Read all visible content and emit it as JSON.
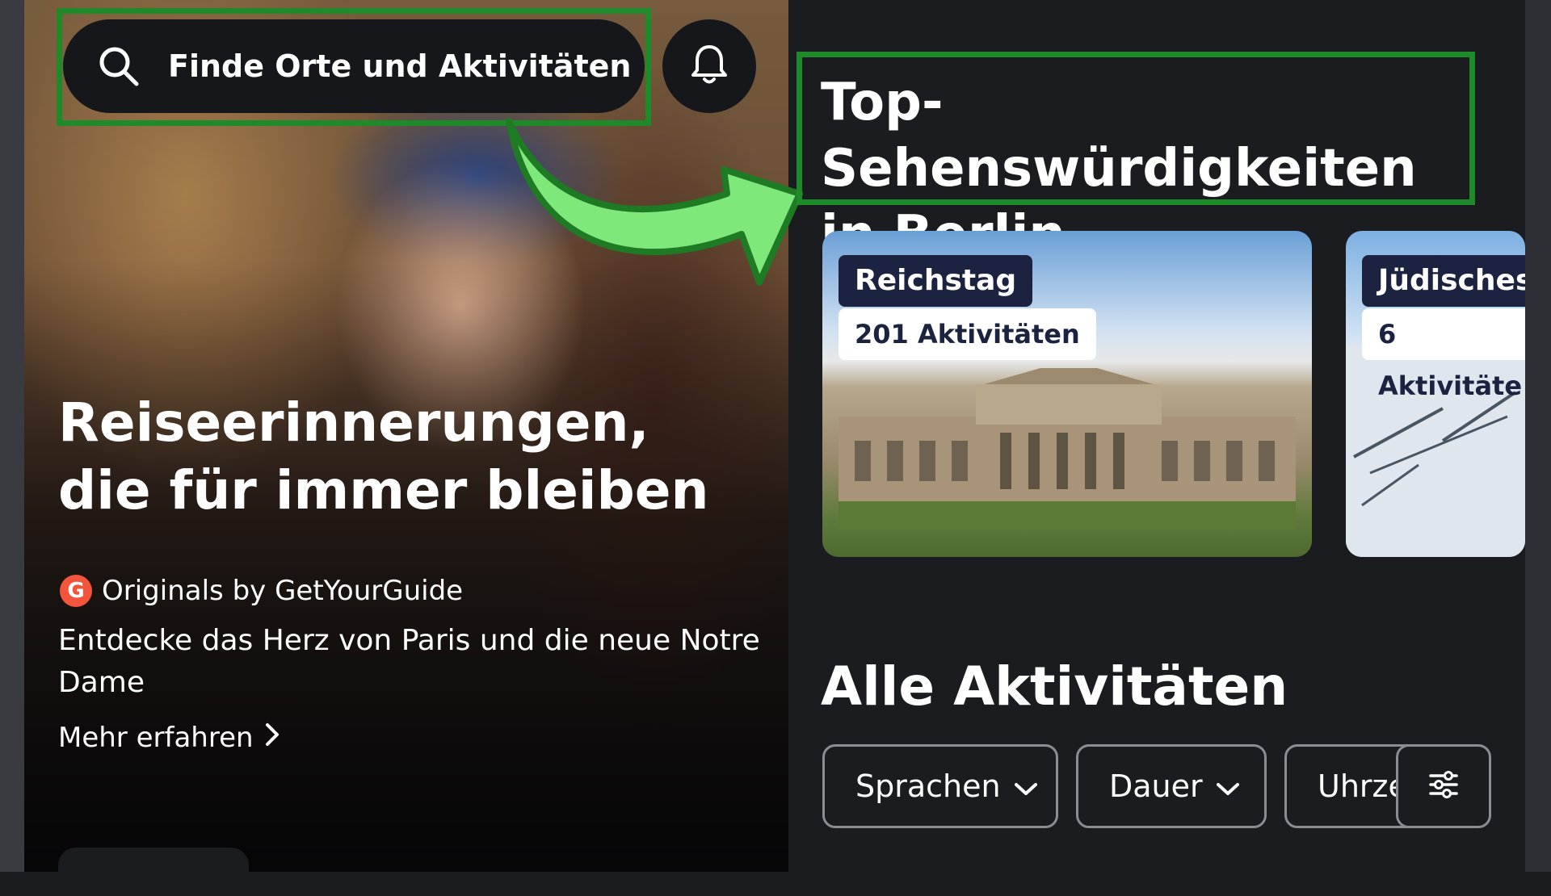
{
  "search": {
    "placeholder": "Finde Orte und Aktivitäten"
  },
  "hero": {
    "title_line1": "Reiseerinnerungen,",
    "title_line2": "die für immer bleiben",
    "brand_badge": "G",
    "brand": "Originals by GetYourGuide",
    "description": "Entdecke das Herz von Paris und die neue Notre Dame",
    "more_link": "Mehr erfahren"
  },
  "top_section": {
    "title_line1": "Top-Sehenswürdigkeiten",
    "title_line2": "in Berlin",
    "cards": [
      {
        "name": "Reichstag",
        "count": "201 Aktivitäten"
      },
      {
        "name": "Jüdisches /",
        "count": "6 Aktivitäte"
      }
    ]
  },
  "all_section": {
    "title": "Alle Aktivitäten",
    "filters": [
      {
        "label": "Sprachen"
      },
      {
        "label": "Dauer"
      },
      {
        "label": "Uhrze"
      }
    ]
  },
  "colors": {
    "highlight": "#1f8a2a",
    "arrow": "#7ee87a",
    "background": "#1b1c20"
  }
}
